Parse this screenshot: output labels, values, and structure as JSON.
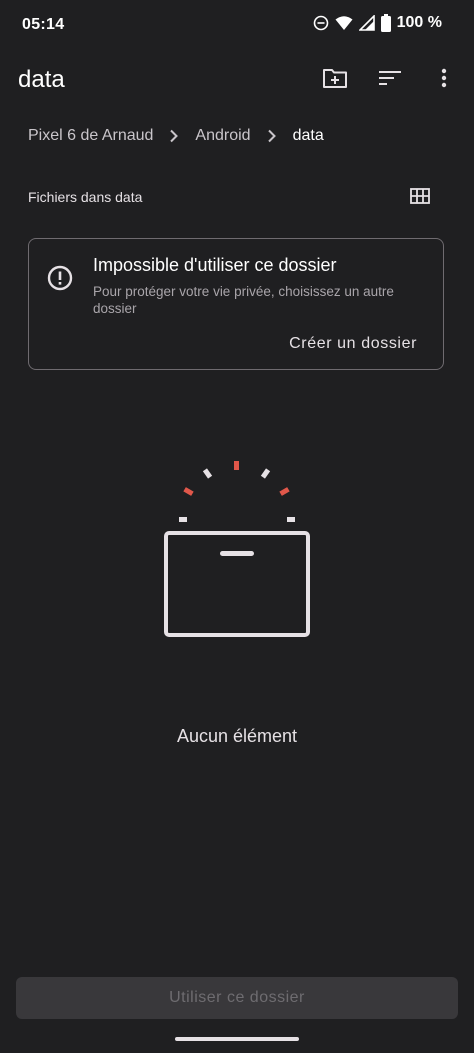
{
  "status_bar": {
    "time": "05:14",
    "battery": "100 %"
  },
  "app_bar": {
    "title": "data"
  },
  "breadcrumb": {
    "items": [
      "Pixel 6 de Arnaud",
      "Android",
      "data"
    ]
  },
  "section": {
    "title": "Fichiers dans data"
  },
  "warning_card": {
    "title": "Impossible d'utiliser ce dossier",
    "description": "Pour protéger votre vie privée, choisissez un autre dossier",
    "action": "Créer un dossier"
  },
  "empty_state": {
    "text": "Aucun élément"
  },
  "footer": {
    "use_button": "Utiliser ce dossier"
  },
  "colors": {
    "background": "#1f1f21",
    "accent_red": "#e0574a",
    "text": "#e6e1e5"
  },
  "icons": [
    "do-not-disturb-icon",
    "wifi-icon",
    "signal-icon",
    "battery-icon",
    "new-folder-icon",
    "sort-icon",
    "more-vert-icon",
    "chevron-right-icon",
    "grid-view-icon",
    "error-icon",
    "empty-box-icon"
  ]
}
